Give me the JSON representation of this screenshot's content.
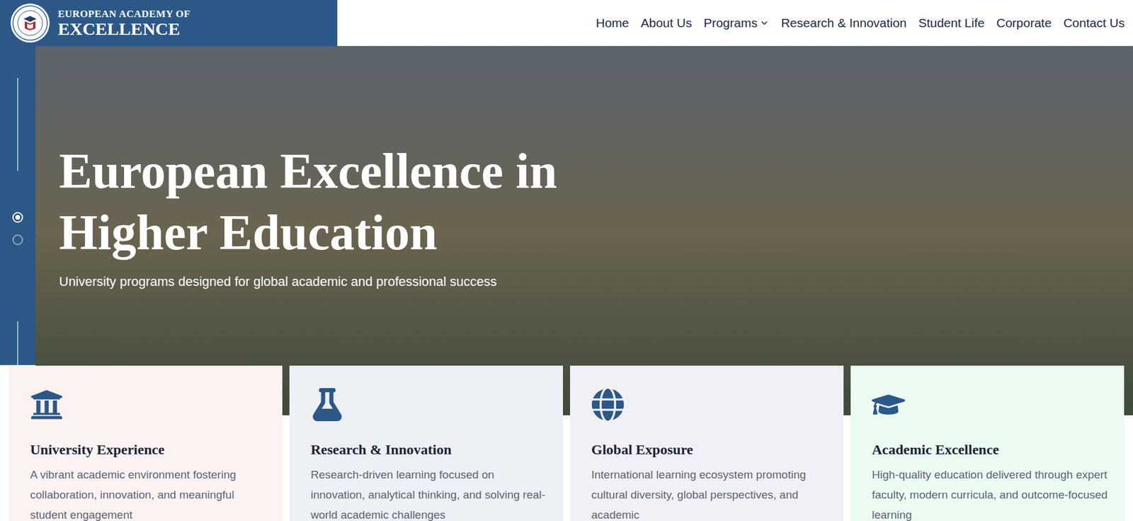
{
  "header": {
    "logo": {
      "line1": "EUROPEAN ACADEMY OF",
      "line2": "EXCELLENCE"
    },
    "nav": [
      {
        "label": "Home",
        "dropdown": false
      },
      {
        "label": "About Us",
        "dropdown": false
      },
      {
        "label": "Programs",
        "dropdown": true
      },
      {
        "label": "Research & Innovation",
        "dropdown": false
      },
      {
        "label": "Student Life",
        "dropdown": false
      },
      {
        "label": "Corporate",
        "dropdown": false
      },
      {
        "label": "Contact Us",
        "dropdown": false
      }
    ]
  },
  "hero": {
    "title": "European Excellence in Higher Education",
    "subtitle": "University programs designed for global academic and professional success",
    "slides": [
      {
        "selected": true
      },
      {
        "selected": false
      }
    ]
  },
  "cards": [
    {
      "title": "University Experience",
      "description": "A vibrant academic environment fostering collaboration, innovation, and meaningful student engagement",
      "color": "#fdf2f2"
    },
    {
      "title": "Research & Innovation",
      "description": "Research-driven learning focused on innovation, analytical thinking, and solving real-world academic challenges",
      "color": "#edf0f4"
    },
    {
      "title": "Global Exposure",
      "description": "International learning ecosystem promoting cultural diversity, global perspectives, and academic",
      "color": "#f2f0f7"
    },
    {
      "title": "Academic Excellence",
      "description": "High-quality education delivered through expert faculty, modern curricula, and outcome-focused learning",
      "color": "#ecfbf2"
    }
  ]
}
